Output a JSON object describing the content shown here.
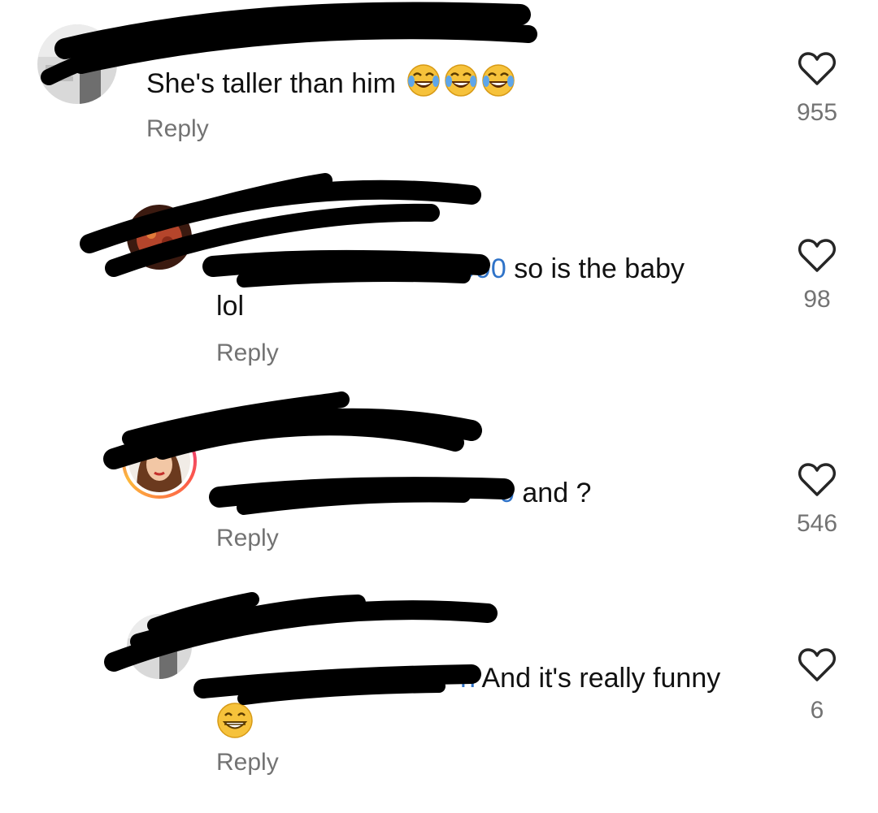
{
  "comments": [
    {
      "text": "She's taller than him",
      "emoji": [
        "face-with-tears-of-joy",
        "face-with-tears-of-joy",
        "face-with-tears-of-joy"
      ],
      "reply_label": "Reply",
      "likes": "955",
      "heart_icon": "heart-outline-icon"
    },
    {
      "mention_visible_fragment": "990",
      "text_line1": "so is the baby",
      "text_line2": "lol",
      "reply_label": "Reply",
      "likes": "98",
      "heart_icon": "heart-outline-icon"
    },
    {
      "mention_visible_fragment": "0",
      "text": "and ?",
      "reply_label": "Reply",
      "likes": "546",
      "heart_icon": "heart-outline-icon"
    },
    {
      "mention_visible_fragment": "n",
      "text": "And it's really funny",
      "emoji": [
        "grinning-face-with-smiling-eyes"
      ],
      "reply_label": "Reply",
      "likes": "6",
      "heart_icon": "heart-outline-icon"
    }
  ],
  "colors": {
    "text": "#111111",
    "secondary": "#737373",
    "mention": "#2f73c8",
    "redaction": "#000000"
  }
}
